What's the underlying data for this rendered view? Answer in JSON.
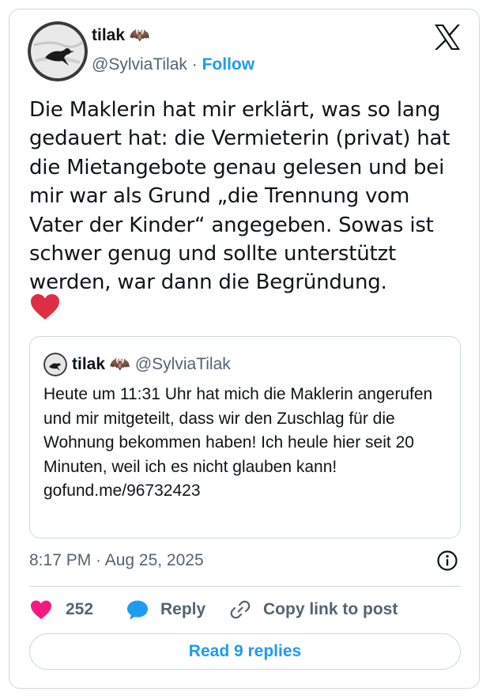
{
  "author": {
    "display_name": "tilak 🦇",
    "handle": "@SylviaTilak",
    "separator": "·",
    "follow_label": "Follow"
  },
  "tweet": {
    "text": "Die Maklerin hat mir erklärt, was so lang gedauert hat: die Vermieterin (privat) hat die Mietangebote genau gelesen und bei mir war als Grund „die Trennung vom Vater der Kinder“ angegeben. Sowas ist schwer genug und sollte unterstützt werden, war dann die Begründung.",
    "trailing_emoji": "red-heart"
  },
  "quoted_tweet": {
    "display_name": "tilak 🦇",
    "handle": "@SylviaTilak",
    "text": "Heute um 11:31 Uhr hat mich die Maklerin angerufen und mir mitgeteilt, dass wir den Zuschlag für die Wohnung bekommen haben! Ich heule hier seit 20 Minuten, weil ich es nicht glauben kann!",
    "link": "gofund.me/96732423"
  },
  "meta": {
    "timestamp": "8:17 PM · Aug 25, 2025"
  },
  "actions": {
    "like_count": "252",
    "reply_label": "Reply",
    "copy_link_label": "Copy link to post"
  },
  "footer": {
    "read_replies_label": "Read 9 replies"
  },
  "colors": {
    "accent": "#1d9bf0",
    "like": "#f91880",
    "border": "#cfd9de",
    "secondary_text": "#536471",
    "heart_emoji": "#dd2e44"
  },
  "icons": [
    "x-logo-icon",
    "info-icon",
    "heart-icon",
    "reply-bubble-icon",
    "link-icon",
    "red-heart-emoji"
  ]
}
